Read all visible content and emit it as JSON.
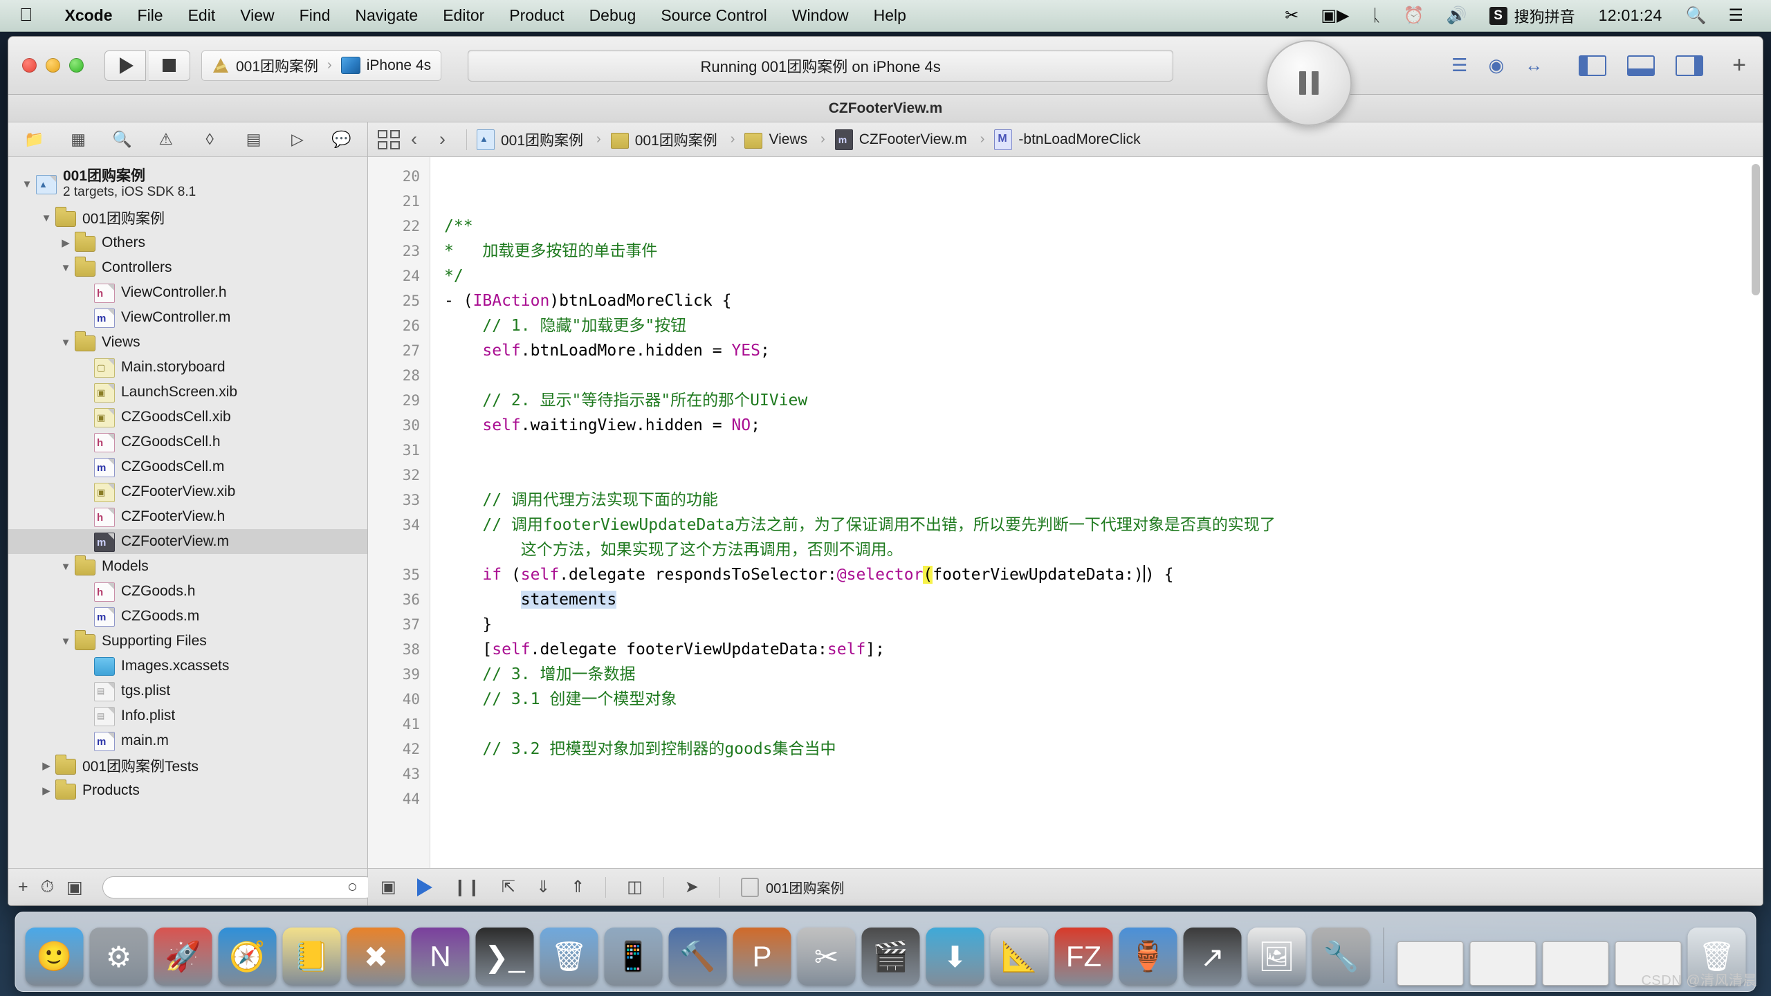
{
  "menubar": {
    "apple_icon": "apple-logo-icon",
    "items": [
      {
        "label": "Xcode",
        "bold": true
      },
      {
        "label": "File",
        "bold": false
      },
      {
        "label": "Edit",
        "bold": false
      },
      {
        "label": "View",
        "bold": false
      },
      {
        "label": "Find",
        "bold": false
      },
      {
        "label": "Navigate",
        "bold": false
      },
      {
        "label": "Editor",
        "bold": false
      },
      {
        "label": "Product",
        "bold": false
      },
      {
        "label": "Debug",
        "bold": false
      },
      {
        "label": "Source Control",
        "bold": false
      },
      {
        "label": "Window",
        "bold": false
      },
      {
        "label": "Help",
        "bold": false
      }
    ],
    "status_icons": [
      "scissors-icon",
      "screen-record-icon",
      "bluetooth-icon",
      "time-machine-icon",
      "volume-icon"
    ],
    "input_badge": "S",
    "input_method": "搜狗拼音",
    "clock": "12:01:24",
    "search_icon": "search-icon",
    "notification_icon": "notification-center-icon"
  },
  "toolbar": {
    "run_icon": "run-play-icon",
    "stop_icon": "stop-square-icon",
    "scheme_project": "001团购案例",
    "scheme_separator": "›",
    "scheme_destination": "iPhone 4s",
    "activity_status": "Running 001团购案例 on iPhone 4s",
    "pause_icon": "pause-button-icon",
    "editor_icons": [
      "standard-editor-icon",
      "assistant-editor-icon",
      "version-editor-icon"
    ],
    "view_icons": [
      "toggle-navigator-icon",
      "toggle-debug-area-icon",
      "toggle-utilities-icon"
    ],
    "add_icon": "plus-icon"
  },
  "window": {
    "title": "CZFooterView.m"
  },
  "navigator": {
    "tab_icons": [
      "project-navigator-icon",
      "symbol-navigator-icon",
      "find-navigator-icon",
      "issue-navigator-icon",
      "test-navigator-icon",
      "debug-navigator-icon",
      "breakpoint-navigator-icon",
      "report-navigator-icon"
    ],
    "active_tab": 0,
    "tree": [
      {
        "depth": 0,
        "twisty": "down",
        "icon": "project-file-icon",
        "label": "001团购案例",
        "sub": "2 targets, iOS SDK 8.1",
        "bold": true,
        "selected": false
      },
      {
        "depth": 1,
        "twisty": "down",
        "icon": "folder-icon",
        "label": "001团购案例",
        "selected": false
      },
      {
        "depth": 2,
        "twisty": "right",
        "icon": "folder-icon",
        "label": "Others",
        "selected": false
      },
      {
        "depth": 2,
        "twisty": "down",
        "icon": "folder-icon",
        "label": "Controllers",
        "selected": false
      },
      {
        "depth": 3,
        "twisty": "none",
        "icon": "header-file-icon",
        "label": "ViewController.h",
        "selected": false
      },
      {
        "depth": 3,
        "twisty": "none",
        "icon": "implementation-file-icon",
        "label": "ViewController.m",
        "selected": false
      },
      {
        "depth": 2,
        "twisty": "down",
        "icon": "folder-icon",
        "label": "Views",
        "selected": false
      },
      {
        "depth": 3,
        "twisty": "none",
        "icon": "storyboard-file-icon",
        "label": "Main.storyboard",
        "selected": false
      },
      {
        "depth": 3,
        "twisty": "none",
        "icon": "xib-file-icon",
        "label": "LaunchScreen.xib",
        "selected": false
      },
      {
        "depth": 3,
        "twisty": "none",
        "icon": "xib-file-icon",
        "label": "CZGoodsCell.xib",
        "selected": false
      },
      {
        "depth": 3,
        "twisty": "none",
        "icon": "header-file-icon",
        "label": "CZGoodsCell.h",
        "selected": false
      },
      {
        "depth": 3,
        "twisty": "none",
        "icon": "implementation-file-icon",
        "label": "CZGoodsCell.m",
        "selected": false
      },
      {
        "depth": 3,
        "twisty": "none",
        "icon": "xib-file-icon",
        "label": "CZFooterView.xib",
        "selected": false
      },
      {
        "depth": 3,
        "twisty": "none",
        "icon": "header-file-icon",
        "label": "CZFooterView.h",
        "selected": false
      },
      {
        "depth": 3,
        "twisty": "none",
        "icon": "implementation-file-icon",
        "label": "CZFooterView.m",
        "selected": true
      },
      {
        "depth": 2,
        "twisty": "down",
        "icon": "folder-icon",
        "label": "Models",
        "selected": false
      },
      {
        "depth": 3,
        "twisty": "none",
        "icon": "header-file-icon",
        "label": "CZGoods.h",
        "selected": false
      },
      {
        "depth": 3,
        "twisty": "none",
        "icon": "implementation-file-icon",
        "label": "CZGoods.m",
        "selected": false
      },
      {
        "depth": 2,
        "twisty": "down",
        "icon": "folder-icon",
        "label": "Supporting Files",
        "selected": false
      },
      {
        "depth": 3,
        "twisty": "none",
        "icon": "xcassets-icon",
        "label": "Images.xcassets",
        "selected": false
      },
      {
        "depth": 3,
        "twisty": "none",
        "icon": "plist-file-icon",
        "label": "tgs.plist",
        "selected": false
      },
      {
        "depth": 3,
        "twisty": "none",
        "icon": "plist-file-icon",
        "label": "Info.plist",
        "selected": false
      },
      {
        "depth": 3,
        "twisty": "none",
        "icon": "implementation-file-icon",
        "label": "main.m",
        "selected": false
      },
      {
        "depth": 1,
        "twisty": "right",
        "icon": "folder-icon",
        "label": "001团购案例Tests",
        "selected": false
      },
      {
        "depth": 1,
        "twisty": "right",
        "icon": "folder-icon",
        "label": "Products",
        "selected": false
      }
    ],
    "footer_icons": [
      "add-file-icon",
      "filter-recent-icon",
      "filter-source-control-icon",
      "filter-unsaved-icon"
    ],
    "filter_placeholder": ""
  },
  "jumpbar": {
    "related_items_icon": "related-items-icon",
    "back_icon": "back-chevron-icon",
    "forward_icon": "forward-chevron-icon",
    "crumbs": [
      {
        "icon": "project-file-icon",
        "label": "001团购案例"
      },
      {
        "icon": "folder-icon",
        "label": "001团购案例"
      },
      {
        "icon": "folder-icon",
        "label": "Views"
      },
      {
        "icon": "implementation-file-icon",
        "label": "CZFooterView.m"
      },
      {
        "icon": "method-marker-icon",
        "label": "-btnLoadMoreClick"
      }
    ]
  },
  "editor": {
    "first_line_number": 20,
    "breakpoint_line": 25,
    "lines": [
      {
        "n": 20,
        "segs": []
      },
      {
        "n": 21,
        "segs": []
      },
      {
        "n": 22,
        "segs": [
          {
            "t": "/**",
            "c": "cmt"
          }
        ]
      },
      {
        "n": 23,
        "segs": [
          {
            "t": "*   加载更多按钮的单击事件",
            "c": "cmt"
          }
        ]
      },
      {
        "n": 24,
        "segs": [
          {
            "t": "*/",
            "c": "cmt"
          }
        ]
      },
      {
        "n": 25,
        "segs": [
          {
            "t": "- (",
            "c": ""
          },
          {
            "t": "IBAction",
            "c": "kw"
          },
          {
            "t": ")btnLoadMoreClick {",
            "c": ""
          }
        ]
      },
      {
        "n": 26,
        "segs": [
          {
            "t": "    ",
            "c": ""
          },
          {
            "t": "// 1. 隐藏\"加载更多\"按钮",
            "c": "cmt"
          }
        ]
      },
      {
        "n": 27,
        "segs": [
          {
            "t": "    ",
            "c": ""
          },
          {
            "t": "self",
            "c": "kw"
          },
          {
            "t": ".btnLoadMore.hidden = ",
            "c": ""
          },
          {
            "t": "YES",
            "c": "kw"
          },
          {
            "t": ";",
            "c": ""
          }
        ]
      },
      {
        "n": 28,
        "segs": []
      },
      {
        "n": 29,
        "segs": [
          {
            "t": "    ",
            "c": ""
          },
          {
            "t": "// 2. 显示\"等待指示器\"所在的那个UIView",
            "c": "cmt"
          }
        ]
      },
      {
        "n": 30,
        "segs": [
          {
            "t": "    ",
            "c": ""
          },
          {
            "t": "self",
            "c": "kw"
          },
          {
            "t": ".waitingView.hidden = ",
            "c": ""
          },
          {
            "t": "NO",
            "c": "kw"
          },
          {
            "t": ";",
            "c": ""
          }
        ]
      },
      {
        "n": 31,
        "segs": []
      },
      {
        "n": 32,
        "segs": []
      },
      {
        "n": 33,
        "segs": [
          {
            "t": "    ",
            "c": ""
          },
          {
            "t": "// 调用代理方法实现下面的功能",
            "c": "cmt"
          }
        ]
      },
      {
        "n": 34,
        "segs": [
          {
            "t": "    ",
            "c": ""
          },
          {
            "t": "// 调用footerViewUpdateData方法之前，为了保证调用不出错，所以要先判断一下代理对象是否真的实现了",
            "c": "cmt"
          }
        ]
      },
      {
        "n": null,
        "segs": [
          {
            "t": "        这个方法，如果实现了这个方法再调用，否则不调用。",
            "c": "cmt"
          }
        ]
      },
      {
        "n": 35,
        "segs": [
          {
            "t": "    ",
            "c": ""
          },
          {
            "t": "if",
            "c": "kw"
          },
          {
            "t": " (",
            "c": ""
          },
          {
            "t": "self",
            "c": "kw"
          },
          {
            "t": ".delegate respondsToSelector:",
            "c": ""
          },
          {
            "t": "@selector",
            "c": "kw"
          },
          {
            "t": "(",
            "c": "hl-yellow"
          },
          {
            "t": "footerViewUpdateData:)",
            "c": ""
          },
          {
            "t": "|",
            "c": "caret"
          },
          {
            "t": ") {",
            "c": ""
          }
        ]
      },
      {
        "n": 36,
        "segs": [
          {
            "t": "        ",
            "c": ""
          },
          {
            "t": "statements",
            "c": "hl-blue"
          }
        ]
      },
      {
        "n": 37,
        "segs": [
          {
            "t": "    }",
            "c": ""
          }
        ]
      },
      {
        "n": 38,
        "segs": [
          {
            "t": "    [",
            "c": ""
          },
          {
            "t": "self",
            "c": "kw"
          },
          {
            "t": ".delegate footerViewUpdateData:",
            "c": ""
          },
          {
            "t": "self",
            "c": "kw"
          },
          {
            "t": "];",
            "c": ""
          }
        ]
      },
      {
        "n": 39,
        "segs": [
          {
            "t": "    ",
            "c": ""
          },
          {
            "t": "// 3. 增加一条数据",
            "c": "cmt"
          }
        ]
      },
      {
        "n": 40,
        "segs": [
          {
            "t": "    ",
            "c": ""
          },
          {
            "t": "// 3.1 创建一个模型对象",
            "c": "cmt"
          }
        ]
      },
      {
        "n": 41,
        "segs": []
      },
      {
        "n": 42,
        "segs": [
          {
            "t": "    ",
            "c": ""
          },
          {
            "t": "// 3.2 把模型对象加到控制器的goods集合当中",
            "c": "cmt"
          }
        ]
      },
      {
        "n": 43,
        "segs": []
      },
      {
        "n": 44,
        "segs": []
      }
    ]
  },
  "debugbar": {
    "icons": [
      "show-debug-area-icon",
      "continue-execution-icon",
      "pause-execution-icon",
      "step-over-icon",
      "step-into-icon",
      "step-out-icon",
      "simulate-location-icon",
      "view-debugging-icon"
    ],
    "process_icon": "process-icon",
    "process_label": "001团购案例"
  },
  "dock": {
    "items": [
      {
        "name": "finder-icon",
        "glyph": "🙂",
        "color": "#4aa8e8"
      },
      {
        "name": "system-preferences-icon",
        "glyph": "⚙",
        "color": "#9aa0a6"
      },
      {
        "name": "launchpad-icon",
        "glyph": "🚀",
        "color": "#d9534f"
      },
      {
        "name": "safari-icon",
        "glyph": "🧭",
        "color": "#2f8fd8"
      },
      {
        "name": "notes-icon",
        "glyph": "📒",
        "color": "#f2df8a"
      },
      {
        "name": "sublime-text-icon",
        "glyph": "✖",
        "color": "#e8822a"
      },
      {
        "name": "onenote-icon",
        "glyph": "N",
        "color": "#7a3f9d"
      },
      {
        "name": "terminal-icon",
        "glyph": "❯_",
        "color": "#2b2b2b"
      },
      {
        "name": "trash-util-icon",
        "glyph": "🗑",
        "color": "#6fa8dc"
      },
      {
        "name": "simulator-icon",
        "glyph": "📱",
        "color": "#8fa8c0"
      },
      {
        "name": "xcode-icon",
        "glyph": "🔨",
        "color": "#4a6fa8"
      },
      {
        "name": "instruments-icon",
        "glyph": "P",
        "color": "#d06a2a"
      },
      {
        "name": "snip-tool-icon",
        "glyph": "✂",
        "color": "#c0c0c0"
      },
      {
        "name": "photobooth-icon",
        "glyph": "🎬",
        "color": "#4a4a4a"
      },
      {
        "name": "app-store-icon",
        "glyph": "⬇",
        "color": "#3fa9d8"
      },
      {
        "name": "calculator-icon",
        "glyph": "📐",
        "color": "#d8d8d8"
      },
      {
        "name": "filezilla-icon",
        "glyph": "FZ",
        "color": "#d83a2a"
      },
      {
        "name": "charles-icon",
        "glyph": "🏺",
        "color": "#4a90d8"
      },
      {
        "name": "network-icon",
        "glyph": "↗",
        "color": "#3a3a3a"
      },
      {
        "name": "preview-icon",
        "glyph": "🖼",
        "color": "#e8e8e8"
      },
      {
        "name": "xcode-alt-icon",
        "glyph": "🔧",
        "color": "#b0b0b0"
      }
    ],
    "window_previews": 4,
    "trash_icon": "trash-icon"
  },
  "watermark": "CSDN @清风清晨"
}
